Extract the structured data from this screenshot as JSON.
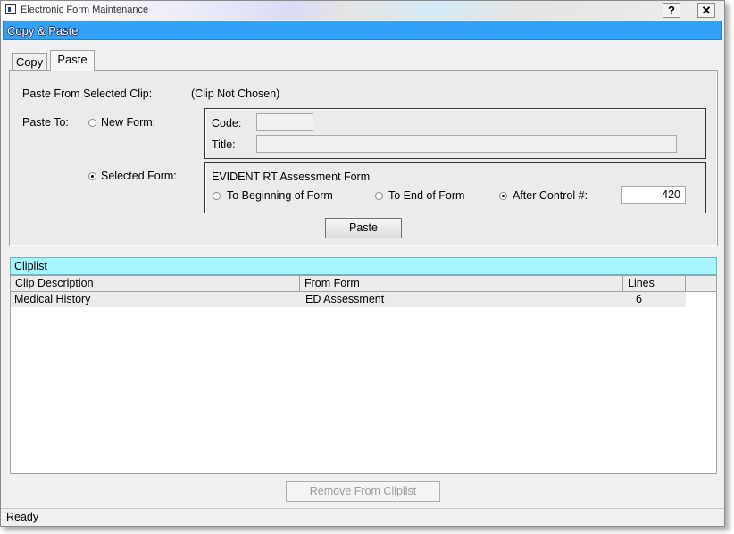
{
  "window": {
    "title": "Electronic Form Maintenance",
    "help_label": "?",
    "close_label": "✕"
  },
  "caption": "Copy & Paste",
  "tabs": [
    {
      "label": "Copy",
      "active": false
    },
    {
      "label": "Paste",
      "active": true
    }
  ],
  "paste": {
    "from_label": "Paste From Selected Clip:",
    "from_value": "(Clip Not Chosen)",
    "to_label": "Paste To:",
    "new_form_label": "New Form:",
    "code_label": "Code:",
    "code_value": "",
    "title_label": "Title:",
    "title_value": "",
    "selected_form_label": "Selected Form:",
    "selected_form_name": "EVIDENT RT Assessment Form",
    "position_options": [
      {
        "label": "To Beginning of Form",
        "selected": false
      },
      {
        "label": "To End of Form",
        "selected": false
      },
      {
        "label": "After Control #:",
        "selected": true
      }
    ],
    "after_control_value": "420",
    "paste_button": "Paste"
  },
  "cliplist": {
    "title": "Cliplist",
    "columns": [
      "Clip Description",
      "From Form",
      "Lines"
    ],
    "rows": [
      [
        "Medical History",
        "ED Assessment",
        "6"
      ]
    ],
    "remove_button": "Remove From Cliplist"
  },
  "status": "Ready",
  "colors": {
    "caption_bg": "#33a1f7",
    "cliplist_header_bg": "#a7f6ff"
  }
}
